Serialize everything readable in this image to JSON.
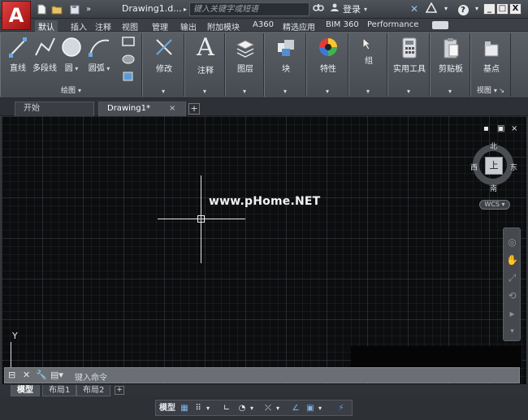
{
  "titlebar": {
    "logo": "A",
    "title": "Drawing1.d...",
    "search_placeholder": "键入关键字或短语",
    "login": "登录",
    "win_minimize": "_",
    "win_maximize": "□",
    "win_close": "X"
  },
  "ribbon_tabs": [
    "默认",
    "插入",
    "注释",
    "视图",
    "管理",
    "输出",
    "附加模块",
    "A360",
    "精选应用",
    "BIM 360",
    "Performance"
  ],
  "ribbon": {
    "draw_tools": [
      "直线",
      "多段线",
      "圆",
      "圆弧"
    ],
    "draw_panel_title": "绘图",
    "modify": "修改",
    "annotate": "注释",
    "layers": "图层",
    "block": "块",
    "properties": "特性",
    "groups": "组",
    "utilities": "实用工具",
    "clipboard": "剪贴板",
    "basepoint": "基点",
    "view_panel_title": "视图"
  },
  "file_tabs": {
    "start": "开始",
    "drawing": "Drawing1*",
    "close": "×",
    "add": "+"
  },
  "viewcube": {
    "north": "北",
    "south": "南",
    "east": "东",
    "west": "西",
    "top": "上",
    "wcs": "WCS"
  },
  "viewport_controls": [
    "▪",
    "▣",
    "×"
  ],
  "watermark": "www.pHome.NET",
  "ucs": {
    "y": "Y"
  },
  "commandline": {
    "placeholder": "键入命令"
  },
  "layout_tabs": {
    "model": "模型",
    "layout1": "布局1",
    "layout2": "布局2",
    "add": "+"
  },
  "statusbar": {
    "model": "模型"
  }
}
